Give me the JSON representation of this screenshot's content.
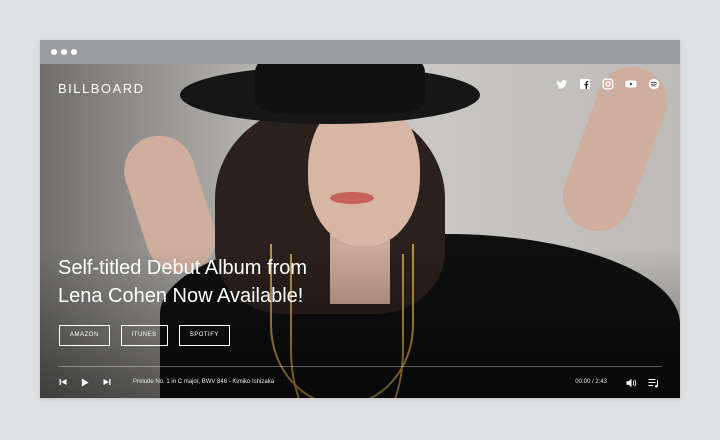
{
  "browser": {
    "dots": [
      "dot",
      "dot",
      "dot"
    ]
  },
  "header": {
    "brand": "BILLBOARD"
  },
  "social": [
    "twitter-icon",
    "facebook-icon",
    "instagram-icon",
    "youtube-icon",
    "spotify-icon"
  ],
  "hero": {
    "headline_line1": "Self-titled Debut Album from",
    "headline_line2": "Lena Cohen Now Available!"
  },
  "buttons": {
    "amazon": "AMAZON",
    "itunes": "ITUNES",
    "spotify": "SPOTIFY"
  },
  "player": {
    "track": "Prelude No. 1 in C major, BWV 846 - Kimiko Ishizaka",
    "time": "00:00 / 2:43",
    "progress": 0
  },
  "colors": {
    "button_border": "#ffffff",
    "chrome": "#9a9ca1",
    "background": "#dfe0e2"
  }
}
